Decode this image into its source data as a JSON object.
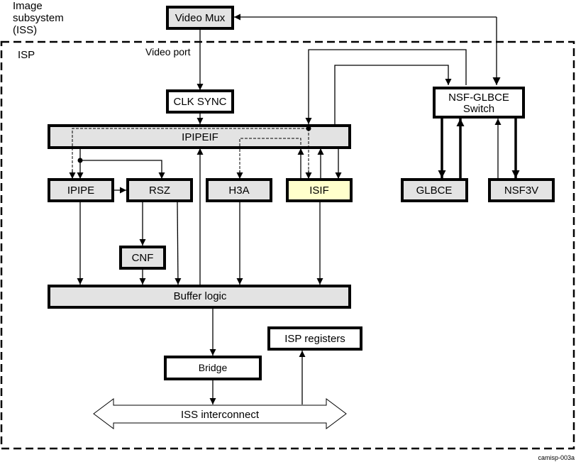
{
  "diagram": {
    "outer_label": [
      "Image",
      "subsystem",
      "(ISS)"
    ],
    "isp_label": "ISP",
    "video_port_label": "Video port",
    "figure_id": "camisp-003a",
    "colors": {
      "gray_fill": "#e3e3e3",
      "isif_fill": "#ffffcc",
      "white_fill": "#ffffff",
      "stroke": "#000000"
    },
    "blocks": {
      "video_mux": "Video Mux",
      "clk_sync": "CLK SYNC",
      "ipipeif": "IPIPEIF",
      "ipipe": "IPIPE",
      "rsz": "RSZ",
      "h3a": "H3A",
      "isif": "ISIF",
      "cnf": "CNF",
      "buffer_logic": "Buffer logic",
      "bridge": "Bridge",
      "isp_registers": "ISP registers",
      "iss_interconnect": "ISS interconnect",
      "nsf_glbce_switch": [
        "NSF-GLBCE",
        "Switch"
      ],
      "glbce": "GLBCE",
      "nsf3v": "NSF3V"
    }
  }
}
